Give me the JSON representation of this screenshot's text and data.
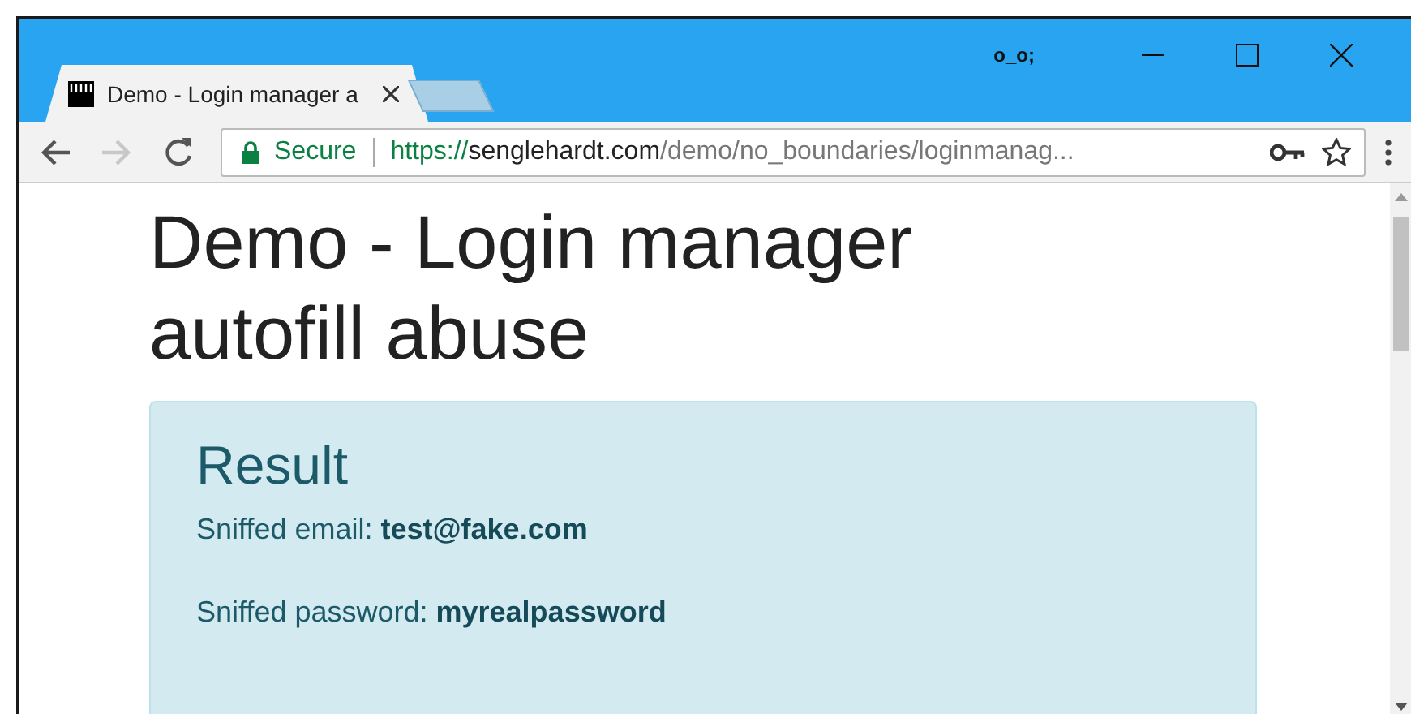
{
  "window": {
    "profile_label": "o_o;"
  },
  "tabs": [
    {
      "title": "Demo - Login manager a",
      "selected": true
    }
  ],
  "toolbar": {
    "secure_label": "Secure",
    "url_scheme": "https://",
    "url_host": "senglehardt.com",
    "url_path": "/demo/no_boundaries/loginmanag...",
    "forward_disabled": true
  },
  "page": {
    "heading": "Demo - Login manager autofill abuse",
    "result": {
      "title": "Result",
      "lines": [
        "Sniffed email: **test@fake.com**",
        "Sniffed password: **myrealpassword**"
      ]
    }
  }
}
